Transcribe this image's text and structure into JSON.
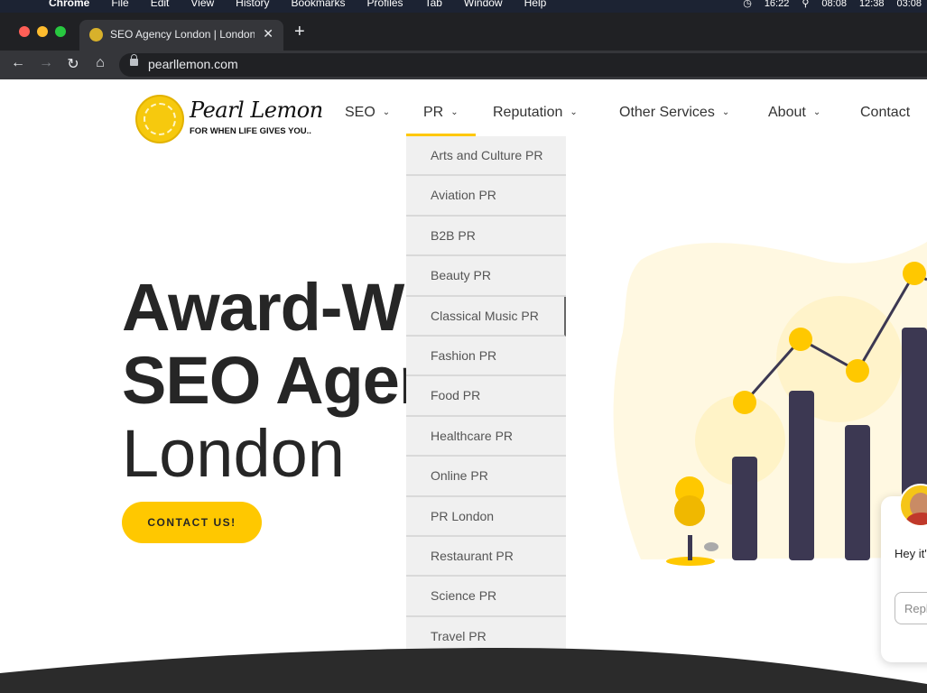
{
  "menubar": {
    "apple_icon": "apple-icon",
    "items": [
      "Chrome",
      "File",
      "Edit",
      "View",
      "History",
      "Bookmarks",
      "Profiles",
      "Tab",
      "Window",
      "Help"
    ],
    "time_main": "16:22",
    "clocks": [
      "08:08",
      "12:38",
      "03:08"
    ]
  },
  "browser": {
    "tab_title": "SEO Agency London | London S",
    "url": "pearllemon.com",
    "colors": {
      "red": "#ff5f57",
      "yellow": "#febc2e",
      "green": "#28c840"
    }
  },
  "site": {
    "logo": {
      "name": "Pearl Lemon",
      "tagline": "FOR WHEN LIFE GIVES YOU.."
    },
    "nav": [
      {
        "label": "SEO"
      },
      {
        "label": "PR"
      },
      {
        "label": "Reputation"
      },
      {
        "label": "Other Services"
      },
      {
        "label": "About"
      },
      {
        "label": "Contact"
      }
    ],
    "dropdown": [
      "Arts and Culture PR",
      "Aviation PR",
      "B2B PR",
      "Beauty PR",
      "Classical Music PR",
      "Fashion PR",
      "Food PR",
      "Healthcare PR",
      "Online PR",
      "PR London",
      "Restaurant PR",
      "Science PR",
      "Travel PR"
    ],
    "hero": {
      "line1": "Award-Wi",
      "line2": "SEO Agen",
      "line3": "London"
    },
    "cta": "CONTACT US!",
    "chat": {
      "message": "Hey it'",
      "reply_placeholder": "Repl"
    },
    "accent": "#ffc800",
    "dark": "#3c3852"
  }
}
